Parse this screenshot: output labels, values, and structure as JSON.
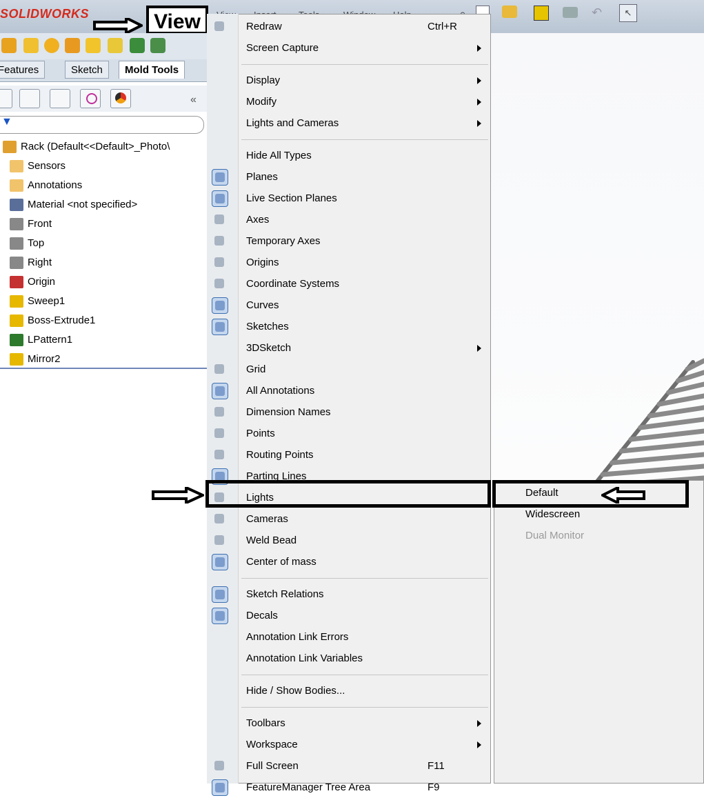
{
  "app": {
    "brand": "SOLIDWORKS",
    "highlight_label": "View"
  },
  "menubar": [
    "View",
    "Insert",
    "Tools",
    "Window",
    "Help"
  ],
  "tabs": [
    {
      "label": "Features",
      "active": false
    },
    {
      "label": "Sketch",
      "active": false
    },
    {
      "label": "Mold Tools",
      "active": true
    }
  ],
  "panel": {
    "collapse_glyph": "«",
    "filter_icon": "funnel-icon"
  },
  "tree": [
    {
      "label": "Rack  (Default<<Default>_Photo\\",
      "icon": "part-icon",
      "color": "#e0a030"
    },
    {
      "label": "Sensors",
      "icon": "sensor-icon",
      "color": "#f1c36b"
    },
    {
      "label": "Annotations",
      "icon": "annotation-icon",
      "color": "#f1c36b"
    },
    {
      "label": "Material <not specified>",
      "icon": "material-icon",
      "color": "#5a6e9a"
    },
    {
      "label": "Front",
      "icon": "plane-icon",
      "color": "#888"
    },
    {
      "label": "Top",
      "icon": "plane-icon",
      "color": "#888"
    },
    {
      "label": "Right",
      "icon": "plane-icon",
      "color": "#888"
    },
    {
      "label": "Origin",
      "icon": "origin-icon",
      "color": "#c53030"
    },
    {
      "label": "Sweep1",
      "icon": "sweep-icon",
      "color": "#e6b800"
    },
    {
      "label": "Boss-Extrude1",
      "icon": "extrude-icon",
      "color": "#e6b800"
    },
    {
      "label": "LPattern1",
      "icon": "pattern-icon",
      "color": "#2d7a2d"
    },
    {
      "label": "Mirror2",
      "icon": "mirror-icon",
      "color": "#e6b800"
    }
  ],
  "menu": {
    "items": [
      {
        "label": "Redraw",
        "shortcut": "Ctrl+R",
        "submenu": false,
        "icon": "redraw-icon",
        "toggled": false,
        "bold": false
      },
      {
        "label": "Screen Capture",
        "shortcut": "",
        "submenu": true,
        "icon": "",
        "toggled": false
      },
      {
        "sep": true
      },
      {
        "label": "Display",
        "shortcut": "",
        "submenu": true,
        "icon": ""
      },
      {
        "label": "Modify",
        "shortcut": "",
        "submenu": true,
        "icon": ""
      },
      {
        "label": "Lights and Cameras",
        "shortcut": "",
        "submenu": true,
        "icon": ""
      },
      {
        "sep": true
      },
      {
        "label": "Hide All Types",
        "shortcut": "",
        "submenu": false,
        "icon": ""
      },
      {
        "label": "Planes",
        "icon": "planes-icon",
        "toggled": true
      },
      {
        "label": "Live Section Planes",
        "icon": "live-section-icon",
        "toggled": true
      },
      {
        "label": "Axes",
        "icon": "axes-icon",
        "toggled": false
      },
      {
        "label": "Temporary Axes",
        "icon": "temp-axes-icon",
        "toggled": false
      },
      {
        "label": "Origins",
        "icon": "origins-icon",
        "toggled": false
      },
      {
        "label": "Coordinate Systems",
        "icon": "coord-sys-icon",
        "toggled": false
      },
      {
        "label": "Curves",
        "icon": "curves-icon",
        "toggled": true
      },
      {
        "label": "Sketches",
        "icon": "sketches-icon",
        "toggled": true
      },
      {
        "label": "3DSketch",
        "icon": "",
        "submenu": true
      },
      {
        "label": "Grid",
        "icon": "grid-icon",
        "toggled": false
      },
      {
        "label": "All Annotations",
        "icon": "annotations-icon",
        "toggled": true
      },
      {
        "label": "Dimension Names",
        "icon": "dim-names-icon",
        "toggled": false
      },
      {
        "label": "Points",
        "icon": "points-icon",
        "toggled": false
      },
      {
        "label": "Routing Points",
        "icon": "routing-points-icon",
        "toggled": false
      },
      {
        "label": "Parting Lines",
        "icon": "parting-lines-icon",
        "toggled": true
      },
      {
        "label": "Lights",
        "icon": "lights-icon",
        "toggled": false
      },
      {
        "label": "Cameras",
        "icon": "cameras-icon",
        "toggled": false
      },
      {
        "label": "Weld Bead",
        "icon": "weld-bead-icon",
        "toggled": false
      },
      {
        "label": "Center of mass",
        "icon": "center-of-mass-icon",
        "toggled": true
      },
      {
        "sep": true
      },
      {
        "label": "Sketch Relations",
        "icon": "sketch-relations-icon",
        "toggled": true
      },
      {
        "label": "Decals",
        "icon": "decals-icon",
        "toggled": true
      },
      {
        "label": "Annotation Link Errors",
        "icon": ""
      },
      {
        "label": "Annotation Link Variables",
        "icon": ""
      },
      {
        "sep": true
      },
      {
        "label": "Hide / Show Bodies...",
        "icon": ""
      },
      {
        "sep": true
      },
      {
        "label": "Toolbars",
        "icon": "",
        "submenu": true
      },
      {
        "label": "Workspace",
        "icon": "",
        "submenu": true,
        "selected": true
      },
      {
        "label": "Full Screen",
        "shortcut": "F11",
        "icon": "fullscreen-icon",
        "toggled": false
      },
      {
        "label": "FeatureManager Tree Area",
        "shortcut": "F9",
        "icon": "feature-tree-icon",
        "toggled": true
      }
    ]
  },
  "submenu": {
    "items": [
      {
        "label": "Default",
        "disabled": false
      },
      {
        "label": "Widescreen",
        "disabled": false
      },
      {
        "label": "Dual Monitor",
        "disabled": true
      }
    ]
  },
  "colors": {
    "accent": "#3c6fb0",
    "brand": "#d52b1e",
    "highlight": "#000000"
  }
}
